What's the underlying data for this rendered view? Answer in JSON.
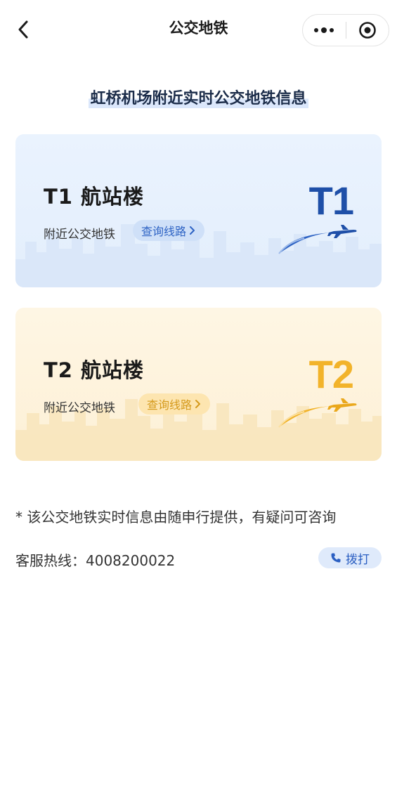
{
  "nav": {
    "title": "公交地铁"
  },
  "headline": "虹桥机场附近实时公交地铁信息",
  "terminals": [
    {
      "name": "T1 航站楼",
      "nearby_label": "附近公交地铁",
      "query_label": "查询线路",
      "badge": "T1",
      "accent": "#1e4fa8"
    },
    {
      "name": "T2 航站楼",
      "nearby_label": "附近公交地铁",
      "query_label": "查询线路",
      "badge": "T2",
      "accent": "#f2b32a"
    }
  ],
  "footer": {
    "note": "* 该公交地铁实时信息由随申行提供，有疑问可咨询",
    "hotline_label": "客服热线：",
    "hotline_number": "4008200022",
    "call_label": "拨打"
  },
  "icons": [
    "back-arrow-icon",
    "more-dots-icon",
    "close-target-icon",
    "chevron-right-icon",
    "airplane-icon",
    "phone-icon"
  ]
}
